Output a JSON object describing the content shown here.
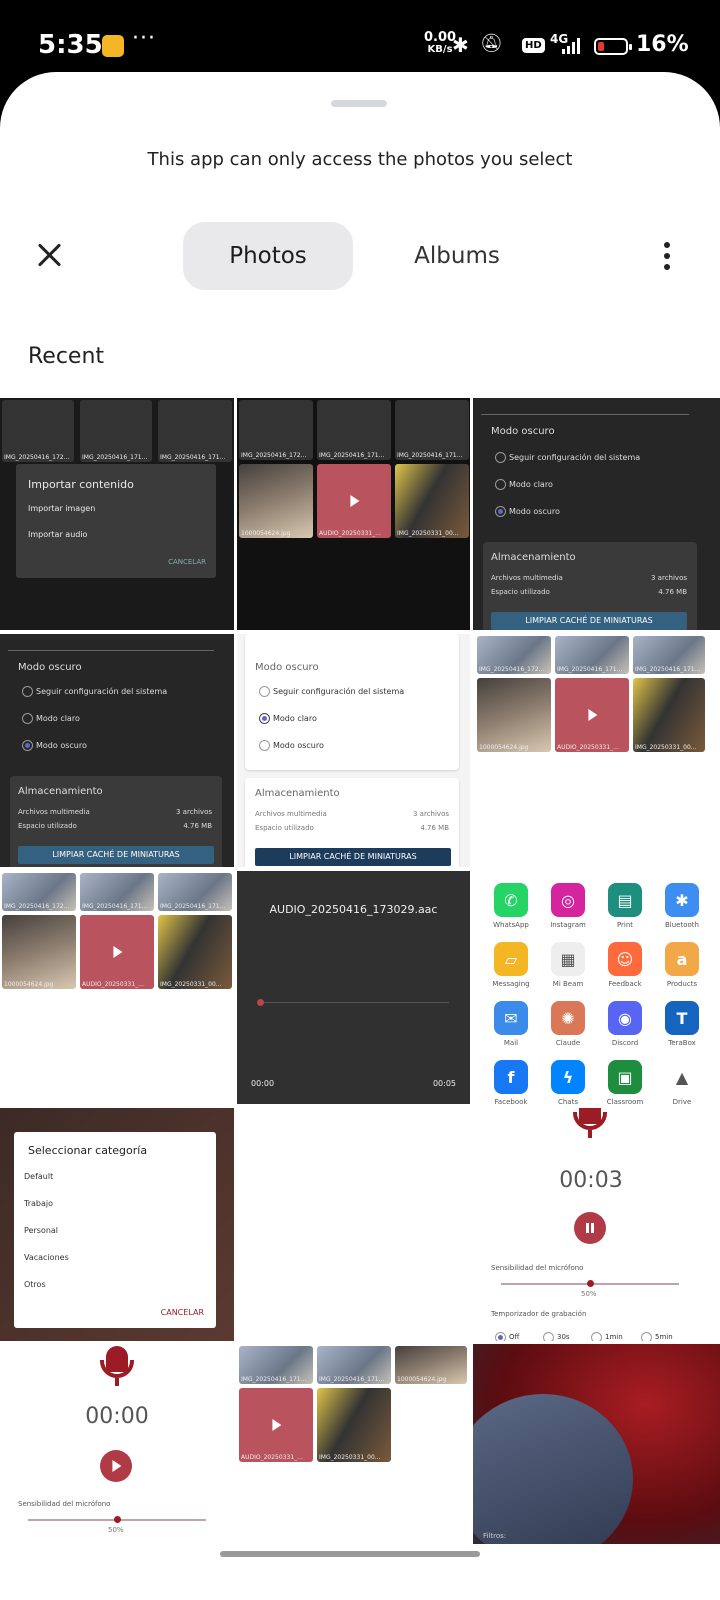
{
  "status_bar": {
    "time": "5:35",
    "net_speed_value": "0.00",
    "net_speed_unit": "KB/s",
    "hd_badge": "HD",
    "network": "4G",
    "battery": "16%",
    "more_dots": "···"
  },
  "picker": {
    "notice": "This app can only access the photos you select",
    "tabs": [
      "Photos",
      "Albums"
    ],
    "section_title": "Recent"
  },
  "tiles": {
    "import": {
      "title": "Importar contenido",
      "opt1": "Importar imagen",
      "opt2": "Importar audio",
      "cancel": "CANCELAR",
      "labels": [
        "IMG_20250416_172...",
        "IMG_20250416_171...",
        "IMG_20250416_171..."
      ]
    },
    "gallery": {
      "labels": [
        "IMG_20250416_172...",
        "IMG_20250416_171...",
        "IMG_20250416_171...",
        "1000054624.jpg",
        "AUDIO_20250331_...",
        "IMG_20250331_00..."
      ]
    },
    "settings": {
      "dark_mode_title": "Modo oscuro",
      "opt_system": "Seguir configuración del sistema",
      "opt_light": "Modo claro",
      "opt_dark": "Modo oscuro",
      "storage_title": "Almacenamiento",
      "media_files_label": "Archivos multimedia",
      "media_files_value": "3 archivos",
      "space_label": "Espacio utilizado",
      "space_value": "4.76 MB",
      "clear_button": "LIMPIAR CACHÉ DE MINIATURAS"
    },
    "audio_player": {
      "file": "AUDIO_20250416_173029.aac",
      "start": "00:00",
      "end": "00:05"
    },
    "share_apps": [
      {
        "name": "WhatsApp",
        "color": "#25d366",
        "glyph": "✆"
      },
      {
        "name": "Instagram",
        "color": "#d6249f",
        "glyph": "◎"
      },
      {
        "name": "Print",
        "color": "#1e8e7e",
        "glyph": "▤"
      },
      {
        "name": "Bluetooth",
        "color": "#3d8ef0",
        "glyph": "✱"
      },
      {
        "name": "Messaging",
        "color": "#f5b625",
        "glyph": "▱"
      },
      {
        "name": "Mi Beam",
        "color": "#eeeeee",
        "glyph": "▦"
      },
      {
        "name": "Feedback",
        "color": "#ff6a3d",
        "glyph": "☺"
      },
      {
        "name": "Products",
        "color": "#f3a847",
        "glyph": "a"
      },
      {
        "name": "Mail",
        "color": "#3b8bea",
        "glyph": "✉"
      },
      {
        "name": "Claude",
        "color": "#d97757",
        "glyph": "✺"
      },
      {
        "name": "Discord",
        "color": "#5865f2",
        "glyph": "◉"
      },
      {
        "name": "TeraBox",
        "color": "#1565c0",
        "glyph": "T"
      },
      {
        "name": "Facebook",
        "color": "#1877f2",
        "glyph": "f"
      },
      {
        "name": "Chats",
        "color": "#0084ff",
        "glyph": "ϟ"
      },
      {
        "name": "Classroom",
        "color": "#1e8e3e",
        "glyph": "▣"
      },
      {
        "name": "Drive",
        "color": "#ffffff",
        "glyph": "▲"
      }
    ],
    "category": {
      "title": "Seleccionar categoría",
      "options": [
        "Default",
        "Trabajo",
        "Personal",
        "Vacaciones",
        "Otros"
      ],
      "cancel": "CANCELAR"
    },
    "recorder": {
      "timer": "00:03",
      "sensitivity_label": "Sensibilidad del micrófono",
      "sensitivity_value": "50%",
      "timer_label": "Temporizador de grabación",
      "timer_options": [
        "Off",
        "30s",
        "1min",
        "5min"
      ]
    },
    "recorder2": {
      "timer": "00:00",
      "sensitivity_label": "Sensibilidad del micrófono",
      "sensitivity_value": "50%"
    },
    "gallery2": {
      "labels": [
        "IMG_20250416_171...",
        "IMG_20250416_171...",
        "1000054624.jpg",
        "AUDIO_20250331_...",
        "IMG_20250331_00..."
      ]
    },
    "last_photo": {
      "caption": "Filtros:"
    }
  }
}
